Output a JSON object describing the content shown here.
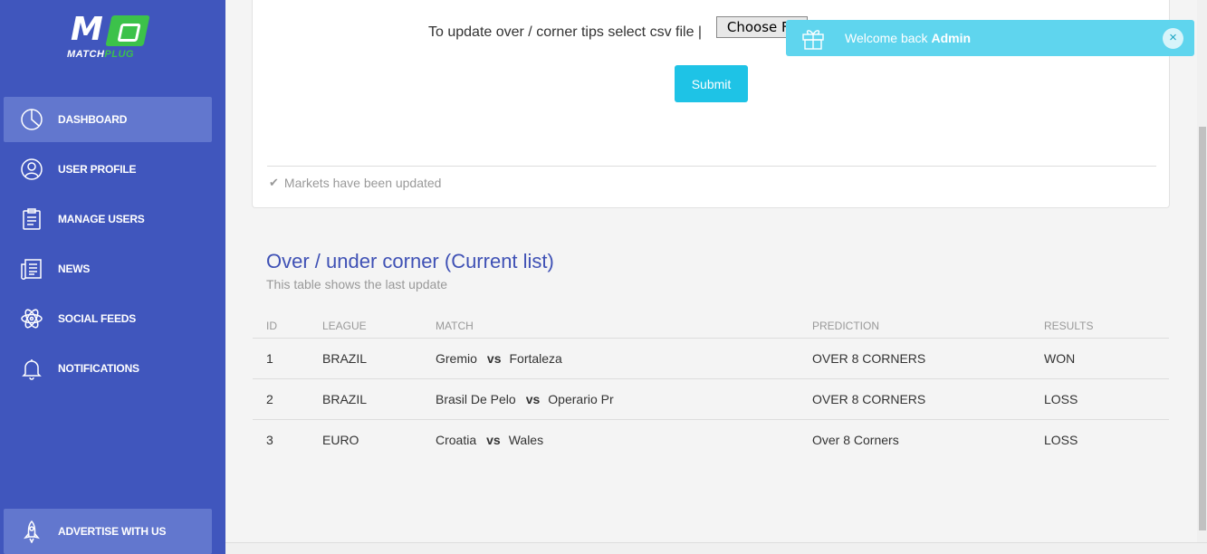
{
  "brand": {
    "mark": "M",
    "word_a": "MATCH",
    "word_b": "PLUG"
  },
  "sidebar": {
    "items": [
      {
        "label": "DASHBOARD",
        "icon": "pie-chart-icon",
        "active": true
      },
      {
        "label": "USER PROFILE",
        "icon": "user-circle-icon",
        "active": false
      },
      {
        "label": "MANAGE USERS",
        "icon": "clipboard-icon",
        "active": false
      },
      {
        "label": "NEWS",
        "icon": "newspaper-icon",
        "active": false
      },
      {
        "label": "SOCIAL FEEDS",
        "icon": "atom-icon",
        "active": false
      },
      {
        "label": "NOTIFICATIONS",
        "icon": "bell-icon",
        "active": false
      }
    ],
    "advertise": {
      "label": "ADVERTISE WITH US",
      "icon": "rocket-icon"
    }
  },
  "upload": {
    "label": "To update over / corner tips select csv file |",
    "file_button": "Choose File",
    "submit": "Submit",
    "status": "Markets have been updated"
  },
  "section": {
    "title": "Over / under corner (Current list)",
    "subtitle": "This table shows the last update"
  },
  "table": {
    "headers": {
      "id": "ID",
      "league": "LEAGUE",
      "match": "MATCH",
      "prediction": "PREDICTION",
      "results": "RESULTS"
    },
    "rows": [
      {
        "id": "1",
        "league": "BRAZIL",
        "home": "Gremio",
        "vs": "vs",
        "away": "Fortaleza",
        "prediction": "OVER 8 CORNERS",
        "result": "WON"
      },
      {
        "id": "2",
        "league": "BRAZIL",
        "home": "Brasil De Pelo",
        "vs": "vs",
        "away": "Operario Pr",
        "prediction": "OVER 8 CORNERS",
        "result": "LOSS"
      },
      {
        "id": "3",
        "league": "EURO",
        "home": "Croatia",
        "vs": "vs",
        "away": "Wales",
        "prediction": "Over 8 Corners",
        "result": "LOSS"
      }
    ]
  },
  "toast": {
    "prefix": "Welcome back ",
    "user": "Admin",
    "close": "×",
    "icon": "gift-icon"
  },
  "colors": {
    "sidebar": "#4056bd",
    "accent": "#1ec3e6",
    "title": "#3f51b5",
    "toast": "#5fd5ee",
    "logo_green": "#3cc24a"
  }
}
